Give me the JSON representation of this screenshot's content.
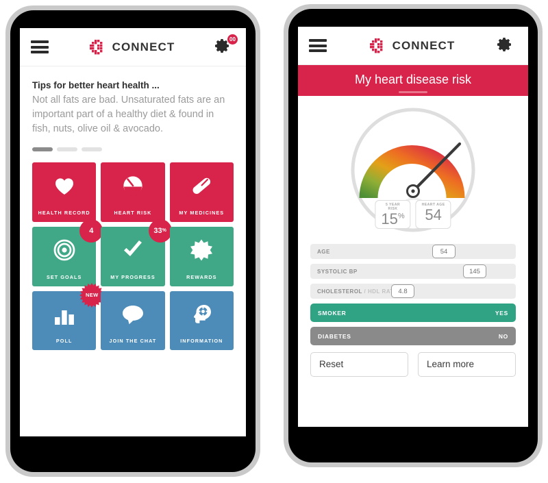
{
  "header": {
    "menu_icon": "hamburger-menu-icon",
    "brand_mark": "connect-c-logo",
    "brand_text": "CONNECT",
    "gear_icon": "gear-icon",
    "gear_badge": "00"
  },
  "left_phone": {
    "tips": {
      "title": "Tips for better heart health ...",
      "body": "Not all fats are bad. Unsaturated fats are an important part of a healthy diet & found in fish, nuts, olive oil & avocado.",
      "pager_total": 3,
      "pager_active": 1
    },
    "tiles": [
      {
        "label": "HEALTH RECORD",
        "icon": "heart-icon",
        "color": "#d8234a",
        "theme": "t-red",
        "badge": null
      },
      {
        "label": "HEART RISK",
        "icon": "speedometer-icon",
        "color": "#d8234a",
        "theme": "t-red",
        "badge": null
      },
      {
        "label": "MY MEDICINES",
        "icon": "pill-icon",
        "color": "#d8234a",
        "theme": "t-red",
        "badge": null
      },
      {
        "label": "SET GOALS",
        "icon": "target-icon",
        "color": "#40a887",
        "theme": "t-teal",
        "badge": {
          "type": "round",
          "text": "4"
        }
      },
      {
        "label": "MY PROGRESS",
        "icon": "checkmark-icon",
        "color": "#40a887",
        "theme": "t-teal",
        "badge": {
          "type": "round",
          "text": "33",
          "suffix": "%"
        }
      },
      {
        "label": "REWARDS",
        "icon": "star-burst-icon",
        "color": "#40a887",
        "theme": "t-teal",
        "badge": null
      },
      {
        "label": "POLL",
        "icon": "bar-chart-icon",
        "color": "#4d8cb8",
        "theme": "t-blue",
        "badge": {
          "type": "starburst",
          "text": "NEW"
        }
      },
      {
        "label": "JOIN THE CHAT",
        "icon": "speech-bubble-icon",
        "color": "#4d8cb8",
        "theme": "t-blue",
        "badge": null
      },
      {
        "label": "INFORMATION",
        "icon": "head-gear-icon",
        "color": "#4d8cb8",
        "theme": "t-blue",
        "badge": null
      }
    ]
  },
  "right_phone": {
    "banner_title": "My heart disease risk",
    "gauge": {
      "name": "risk-gauge",
      "needle_value_percent": 15,
      "arc_colors": [
        "#5d9e3f",
        "#9cb83a",
        "#e8a21c",
        "#ef7522",
        "#d8234a"
      ],
      "readouts": [
        {
          "label": "5 YEAR RISK",
          "value": "15",
          "suffix": "%"
        },
        {
          "label": "HEART AGE",
          "value": "54",
          "suffix": ""
        }
      ]
    },
    "sliders": [
      {
        "label": "AGE",
        "label_muted": "",
        "value": "54",
        "fill_percent": 65
      },
      {
        "label": "SYSTOLIC BP",
        "label_muted": "",
        "value": "145",
        "fill_percent": 80
      },
      {
        "label": "CHOLESTEROL",
        "label_muted": " / HDL RATIO",
        "value": "4.8",
        "fill_percent": 45
      }
    ],
    "toggles": [
      {
        "label": "SMOKER",
        "value": "YES",
        "state": "on",
        "color": "#2fa383"
      },
      {
        "label": "DIABETES",
        "value": "NO",
        "state": "off",
        "color": "#8a8a8a"
      }
    ],
    "buttons": [
      {
        "label": "Reset"
      },
      {
        "label": "Learn more"
      }
    ]
  }
}
